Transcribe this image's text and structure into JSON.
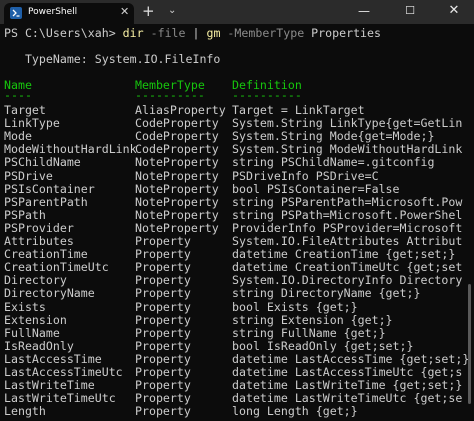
{
  "window": {
    "tab_title": "PowerShell",
    "tab_close": "✕",
    "new_tab": "+",
    "dropdown": "⌄",
    "minimize": "—",
    "maximize": "☐",
    "close": "✕"
  },
  "terminal": {
    "prompt_prefix": "PS C:\\Users\\xah> ",
    "cmd1": "dir",
    "cmd1_param": " -file",
    "pipe": " | ",
    "cmd2": "gm",
    "cmd2_param": " -MemberType",
    "cmd2_arg": " Properties",
    "type_name": "   TypeName: System.IO.FileInfo",
    "headers": {
      "name": "Name",
      "member_type": "MemberType",
      "definition": "Definition"
    },
    "underlines": {
      "name": "----",
      "member_type": "----------",
      "definition": "----------"
    },
    "rows": [
      {
        "name": "Target",
        "type": "AliasProperty",
        "def": "Target = LinkTarget"
      },
      {
        "name": "LinkType",
        "type": "CodeProperty",
        "def": "System.String LinkType{get=GetLin"
      },
      {
        "name": "Mode",
        "type": "CodeProperty",
        "def": "System.String Mode{get=Mode;}"
      },
      {
        "name": "ModeWithoutHardLink",
        "type": "CodeProperty",
        "def": "System.String ModeWithoutHardLink"
      },
      {
        "name": "PSChildName",
        "type": "NoteProperty",
        "def": "string PSChildName=.gitconfig"
      },
      {
        "name": "PSDrive",
        "type": "NoteProperty",
        "def": "PSDriveInfo PSDrive=C"
      },
      {
        "name": "PSIsContainer",
        "type": "NoteProperty",
        "def": "bool PSIsContainer=False"
      },
      {
        "name": "PSParentPath",
        "type": "NoteProperty",
        "def": "string PSParentPath=Microsoft.Pow"
      },
      {
        "name": "PSPath",
        "type": "NoteProperty",
        "def": "string PSPath=Microsoft.PowerShel"
      },
      {
        "name": "PSProvider",
        "type": "NoteProperty",
        "def": "ProviderInfo PSProvider=Microsoft"
      },
      {
        "name": "Attributes",
        "type": "Property",
        "def": "System.IO.FileAttributes Attribut"
      },
      {
        "name": "CreationTime",
        "type": "Property",
        "def": "datetime CreationTime {get;set;}"
      },
      {
        "name": "CreationTimeUtc",
        "type": "Property",
        "def": "datetime CreationTimeUtc {get;set"
      },
      {
        "name": "Directory",
        "type": "Property",
        "def": "System.IO.DirectoryInfo Directory"
      },
      {
        "name": "DirectoryName",
        "type": "Property",
        "def": "string DirectoryName {get;}"
      },
      {
        "name": "Exists",
        "type": "Property",
        "def": "bool Exists {get;}"
      },
      {
        "name": "Extension",
        "type": "Property",
        "def": "string Extension {get;}"
      },
      {
        "name": "FullName",
        "type": "Property",
        "def": "string FullName {get;}"
      },
      {
        "name": "IsReadOnly",
        "type": "Property",
        "def": "bool IsReadOnly {get;set;}"
      },
      {
        "name": "LastAccessTime",
        "type": "Property",
        "def": "datetime LastAccessTime {get;set;}"
      },
      {
        "name": "LastAccessTimeUtc",
        "type": "Property",
        "def": "datetime LastAccessTimeUtc {get;s"
      },
      {
        "name": "LastWriteTime",
        "type": "Property",
        "def": "datetime LastWriteTime {get;set;}"
      },
      {
        "name": "LastWriteTimeUtc",
        "type": "Property",
        "def": "datetime LastWriteTimeUtc {get;se"
      },
      {
        "name": "Length",
        "type": "Property",
        "def": "long Length {get;}"
      }
    ]
  },
  "colors": {
    "background": "#0c0c0c",
    "titlebar": "#2b2b2b",
    "text": "#cccccc",
    "command": "#f9f1a5",
    "parameter": "#8a8a8a",
    "header": "#16c60c",
    "pipe_arg": "#cccccc"
  },
  "icons": {
    "tab": "powershell-icon"
  }
}
